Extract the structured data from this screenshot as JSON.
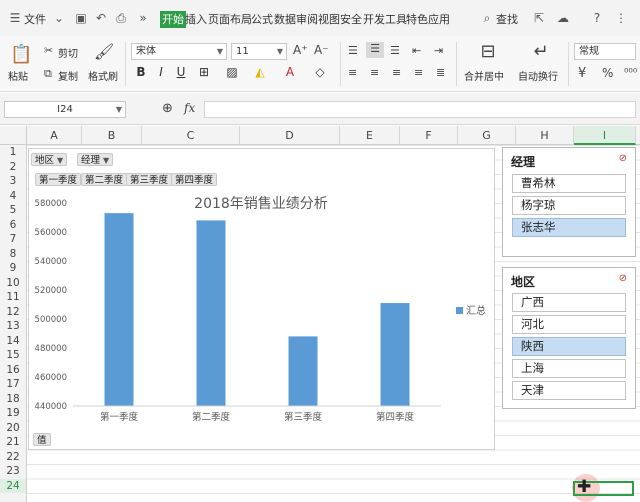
{
  "menubar": {
    "file_label": "文件",
    "tabs": [
      "开始",
      "插入",
      "页面布局",
      "公式",
      "数据",
      "审阅",
      "视图",
      "安全",
      "开发工具",
      "特色应用"
    ],
    "active_tab": "开始",
    "search_label": "查找",
    "help_label": "?"
  },
  "ribbon": {
    "paste_label": "粘贴",
    "cut_label": "剪切",
    "copy_label": "复制",
    "format_painter_label": "格式刷",
    "font_name": "宋体",
    "font_size": "11",
    "merge_label": "合并居中",
    "wrap_label": "自动换行",
    "number_format": "常规",
    "accent_color": "#2f9e48"
  },
  "formula_bar": {
    "cell_ref": "I24",
    "fx_label": "fx",
    "content": ""
  },
  "grid": {
    "columns": [
      "A",
      "B",
      "C",
      "D",
      "E",
      "F",
      "G",
      "H",
      "I"
    ],
    "selected_column": "I",
    "rows": [
      "1",
      "2",
      "3",
      "4",
      "5",
      "6",
      "7",
      "8",
      "9",
      "10",
      "11",
      "12",
      "13",
      "14",
      "15",
      "16",
      "17",
      "18",
      "19",
      "20",
      "21",
      "22",
      "23",
      "24"
    ],
    "selected_row": "24",
    "selected_cell": "I24"
  },
  "pivot": {
    "filter_buttons": [
      "地区",
      "经理"
    ],
    "column_buttons": [
      "第一季度",
      "第二季度",
      "第三季度",
      "第四季度"
    ],
    "value_button": "值"
  },
  "chart_data": {
    "type": "bar",
    "title": "2018年销售业绩分析",
    "categories": [
      "第一季度",
      "第二季度",
      "第三季度",
      "第四季度"
    ],
    "series": [
      {
        "name": "汇总",
        "values": [
          573000,
          568000,
          488000,
          511000
        ],
        "color": "#5b9bd5"
      }
    ],
    "ylim": [
      440000,
      580000
    ],
    "yticks": [
      "580000",
      "560000",
      "540000",
      "520000",
      "500000",
      "480000",
      "460000",
      "440000"
    ],
    "ytick_values": [
      580000,
      560000,
      540000,
      520000,
      500000,
      480000,
      460000,
      440000
    ],
    "grid": false,
    "legend": "right"
  },
  "slicers": {
    "manager": {
      "title": "经理",
      "items": [
        "曹希林",
        "杨字琼",
        "张志华"
      ],
      "selected": [
        "张志华"
      ]
    },
    "region": {
      "title": "地区",
      "items": [
        "广西",
        "河北",
        "陕西",
        "上海",
        "天津"
      ],
      "selected": [
        "陕西"
      ]
    }
  }
}
